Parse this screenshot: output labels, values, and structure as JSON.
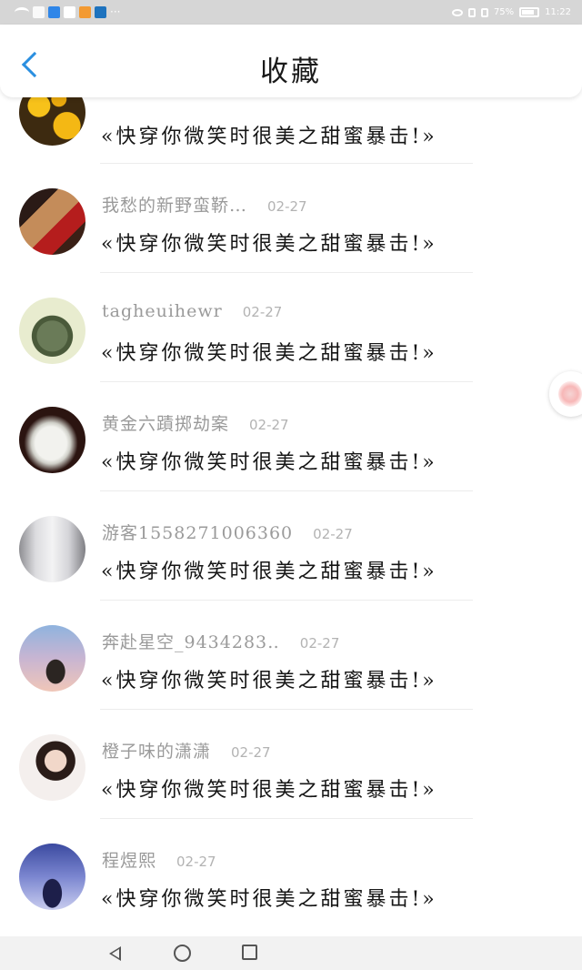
{
  "colors": {
    "accent": "#2a8fe0",
    "name_gray": "#9a9a9a",
    "date_gray": "#b3b3b3",
    "status_bar": "#d6d6d6"
  },
  "status": {
    "battery": "75%",
    "time": "11:22",
    "app_icons": [
      "wifi-icon",
      "sim-icon",
      "search-app-icon",
      "wechat-icon",
      "orange-app-icon",
      "blue-app-icon"
    ]
  },
  "header": {
    "title": "收藏",
    "back_icon": "chevron-left-icon"
  },
  "items": [
    {
      "name": "",
      "date": "",
      "text": "«快穿你微笑时很美之甜蜜暴击!»",
      "avatar": "yellow-flowers"
    },
    {
      "name": "我愁的新野蛮鞒…",
      "date": "02-27",
      "text": "«快穿你微笑时很美之甜蜜暴击!»",
      "avatar": "girl-red"
    },
    {
      "name": "tagheuihewr",
      "date": "02-27",
      "text": "«快穿你微笑时很美之甜蜜暴击!»",
      "avatar": "cartoon-monkey"
    },
    {
      "name": "黄金六蹟掷劫案",
      "date": "02-27",
      "text": "«快穿你微笑时很美之甜蜜暴击!»",
      "avatar": "jade-rabbit"
    },
    {
      "name": "游客1558271006360",
      "date": "02-27",
      "text": "«快穿你微笑时很美之甜蜜暴击!»",
      "avatar": "snow-trees"
    },
    {
      "name": "奔赴星空_9434283‥",
      "date": "02-27",
      "text": "«快穿你微笑时很美之甜蜜暴击!»",
      "avatar": "girl-sunset"
    },
    {
      "name": "橙子味的潇潇",
      "date": "02-27",
      "text": "«快穿你微笑时很美之甜蜜暴击!»",
      "avatar": "girl-white"
    },
    {
      "name": "程煜熙",
      "date": "02-27",
      "text": "«快穿你微笑时很美之甜蜜暴击!»",
      "avatar": "starry-sky"
    }
  ],
  "navbar": {
    "icons": [
      "back-triangle-icon",
      "home-circle-icon",
      "recent-square-icon"
    ]
  }
}
